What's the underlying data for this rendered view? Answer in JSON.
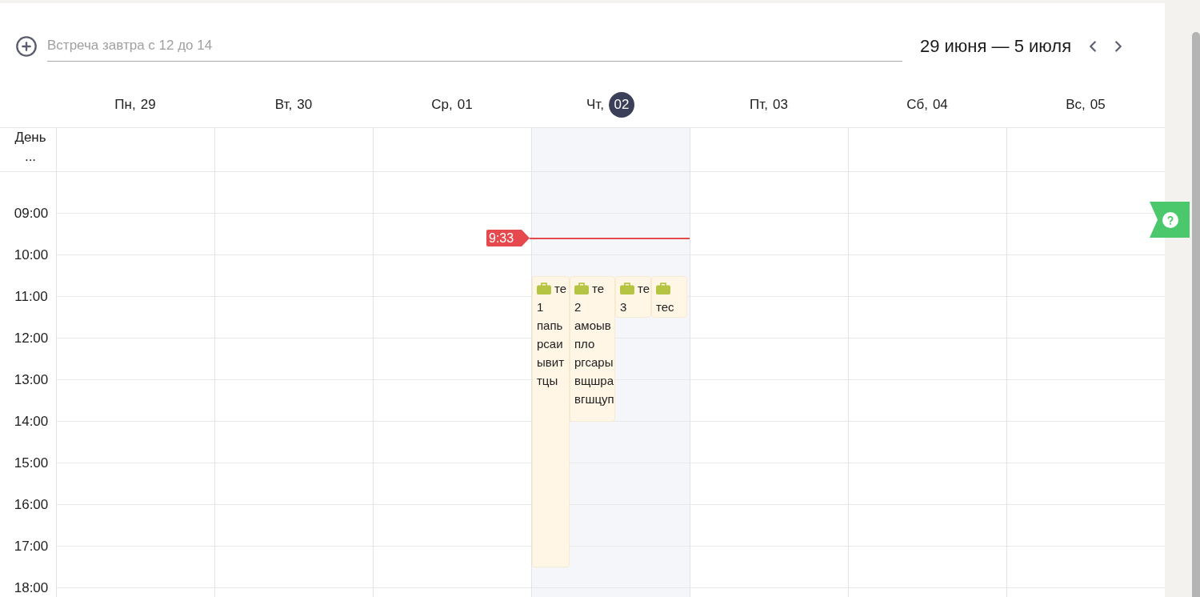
{
  "toolbar": {
    "quick_add": {
      "placeholder": "Встреча завтра с 12 до 14"
    },
    "date_range": "29 июня — 5 июля"
  },
  "grid": {
    "all_day_label": "День ...",
    "hours": [
      "09:00",
      "10:00",
      "11:00",
      "12:00",
      "13:00",
      "14:00",
      "15:00",
      "16:00",
      "17:00",
      "18:00"
    ]
  },
  "days": [
    {
      "weekday": "Пн,",
      "date": "29",
      "today": false
    },
    {
      "weekday": "Вт,",
      "date": "30",
      "today": false
    },
    {
      "weekday": "Ср,",
      "date": "01",
      "today": false
    },
    {
      "weekday": "Чт,",
      "date": "02",
      "today": true,
      "events": [
        {
          "title": "те",
          "lines": [
            "1",
            "папь",
            "рсаи",
            "ывит",
            "тцы"
          ]
        },
        {
          "title": "те",
          "lines": [
            "2",
            "амоыв",
            "пло",
            "ргсары",
            "вщшра",
            "вгшцуп"
          ]
        },
        {
          "title": "те",
          "lines": [
            "3"
          ]
        },
        {
          "lines": [
            "тес"
          ]
        }
      ]
    },
    {
      "weekday": "Пт,",
      "date": "03",
      "today": false
    },
    {
      "weekday": "Сб,",
      "date": "04",
      "today": false
    },
    {
      "weekday": "Вс,",
      "date": "05",
      "today": false
    }
  ],
  "now_marker": {
    "time": "9:33"
  }
}
